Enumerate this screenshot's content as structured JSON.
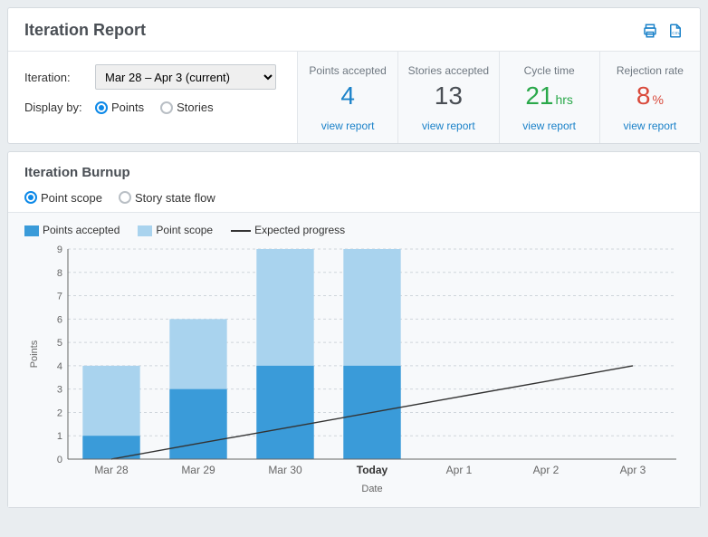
{
  "report": {
    "title": "Iteration Report",
    "controls": {
      "iteration_label": "Iteration:",
      "iteration_selected": "Mar 28 – Apr 3 (current)",
      "display_by_label": "Display by:",
      "options": {
        "points": "Points",
        "stories": "Stories"
      },
      "view_report": "view report"
    },
    "metrics": [
      {
        "label": "Points accepted",
        "value": "4",
        "unit": "",
        "tone": "blue"
      },
      {
        "label": "Stories accepted",
        "value": "13",
        "unit": "",
        "tone": "gray"
      },
      {
        "label": "Cycle time",
        "value": "21",
        "unit": "hrs",
        "tone": "green"
      },
      {
        "label": "Rejection rate",
        "value": "8",
        "unit": "%",
        "tone": "red"
      }
    ]
  },
  "burnup": {
    "title": "Iteration Burnup",
    "options": {
      "point_scope": "Point scope",
      "story_state": "Story state flow"
    },
    "legend": {
      "accepted": "Points accepted",
      "scope": "Point scope",
      "expected": "Expected progress"
    },
    "yaxis_label": "Points",
    "xaxis_label": "Date"
  },
  "chart_data": {
    "type": "bar",
    "title": "Iteration Burnup",
    "xlabel": "Date",
    "ylabel": "Points",
    "ylim": [
      0,
      9
    ],
    "categories": [
      "Mar 28",
      "Mar 29",
      "Mar 30",
      "Today",
      "Apr 1",
      "Apr 2",
      "Apr 3"
    ],
    "series": [
      {
        "name": "Points accepted",
        "values": [
          1,
          3,
          4,
          4,
          null,
          null,
          null
        ]
      },
      {
        "name": "Point scope",
        "values": [
          4,
          6,
          9,
          9,
          null,
          null,
          null
        ]
      },
      {
        "name": "Expected progress",
        "type": "line",
        "values": [
          0,
          0.67,
          1.33,
          2,
          2.67,
          3.33,
          4
        ]
      }
    ]
  },
  "colors": {
    "accepted": "#3a9bd9",
    "scope": "#a9d3ee",
    "line": "#333333"
  }
}
